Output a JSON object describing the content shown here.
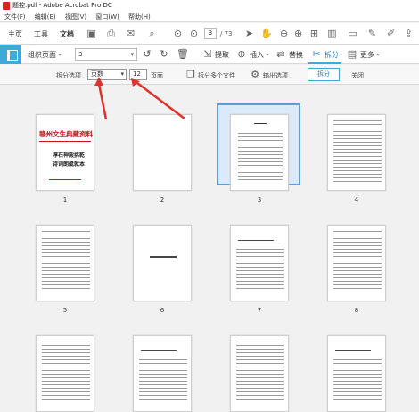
{
  "window": {
    "title": "题控.pdf - Adobe Acrobat Pro DC"
  },
  "menu": [
    "文件(F)",
    "编辑(E)",
    "视图(V)",
    "窗口(W)",
    "帮助(H)"
  ],
  "main_tabs": {
    "home": "主页",
    "tools": "工具",
    "document": "文档"
  },
  "page_nav": {
    "current": "3",
    "total": "/ 73"
  },
  "organize": {
    "title": "组织页面 -",
    "zoom_value": "3",
    "extract": "提取",
    "insert": "插入 -",
    "replace": "替换",
    "split": "拆分",
    "more": "更多 -"
  },
  "split_bar": {
    "options_label": "拆分选项",
    "mode_value": "页数",
    "page_count": "12",
    "page_unit": "页面",
    "multi_file": "拆分多个文件",
    "output_options": "输出选项",
    "split_button": "拆分",
    "close_button": "关闭"
  },
  "cover_page": {
    "line1": "赣州文生典藏资料",
    "line2": "淳石神殿挑乾",
    "line3": "诗词朗艇就本"
  },
  "thumbnails": [
    {
      "label": "1"
    },
    {
      "label": "2"
    },
    {
      "label": "3"
    },
    {
      "label": "4"
    },
    {
      "label": "5"
    },
    {
      "label": "6"
    },
    {
      "label": "7"
    },
    {
      "label": "8"
    }
  ],
  "accent_color": "#3fa9d9",
  "annotation_color": "#e0312c"
}
